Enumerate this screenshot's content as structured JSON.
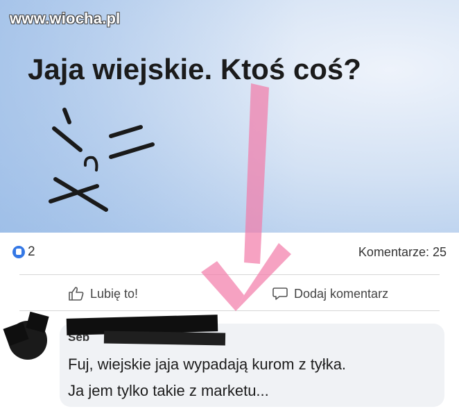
{
  "watermark": "www.wiocha.pl",
  "post": {
    "text": "Jaja wiejskie. Ktoś coś?"
  },
  "stats": {
    "reaction_count": "2",
    "comments_label": "Komentarze: 25"
  },
  "actions": {
    "like_label": "Lubię to!",
    "comment_label": "Dodaj komentarz"
  },
  "comment": {
    "author": "Seb",
    "lines": [
      "Fuj, wiejskie jaja wypadają kurom z tyłka.",
      "Ja jem tylko takie z marketu..."
    ]
  },
  "colors": {
    "reaction_blue": "#3578e5",
    "arrow_pink": "#f27aa8"
  }
}
